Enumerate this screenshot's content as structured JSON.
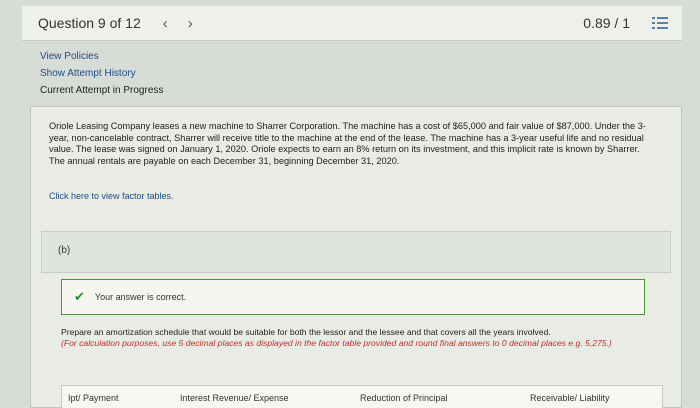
{
  "header": {
    "question_label": "Question 9 of 12",
    "prev_icon": "‹",
    "next_icon": "›",
    "score": "0.89 / 1",
    "list_icon": "list-icon"
  },
  "links": {
    "view_policies": "View Policies",
    "show_attempt_history": "Show Attempt History",
    "current_attempt": "Current Attempt in Progress"
  },
  "problem": {
    "text": "Oriole Leasing Company leases a new machine to Sharrer Corporation. The machine has a cost of $65,000 and fair value of $87,000. Under the 3-year, non-cancelable contract, Sharrer will receive title to the machine at the end of the lease. The machine has a 3-year useful life and no residual value. The lease was signed on January 1, 2020. Oriole expects to earn an 8% return on its investment, and this implicit rate is known by Sharrer. The annual rentals are payable on each December 31, beginning December 31, 2020.",
    "factor_link": "Click here to view factor tables."
  },
  "part": {
    "label": "(b)"
  },
  "feedback": {
    "icon": "✔",
    "text": "Your answer is correct."
  },
  "instructions": {
    "main": "Prepare an amortization schedule that would be suitable for both the lessor and the lessee and that covers all the years involved.",
    "note": "(For calculation purposes, use 5 decimal places as displayed in the factor table provided and round final answers to 0 decimal places e.g. 5,275.)"
  },
  "table": {
    "headers": [
      "Ipt/ Payment",
      "Interest Revenue/ Expense",
      "Reduction of Principal",
      "Receivable/ Liability"
    ]
  }
}
